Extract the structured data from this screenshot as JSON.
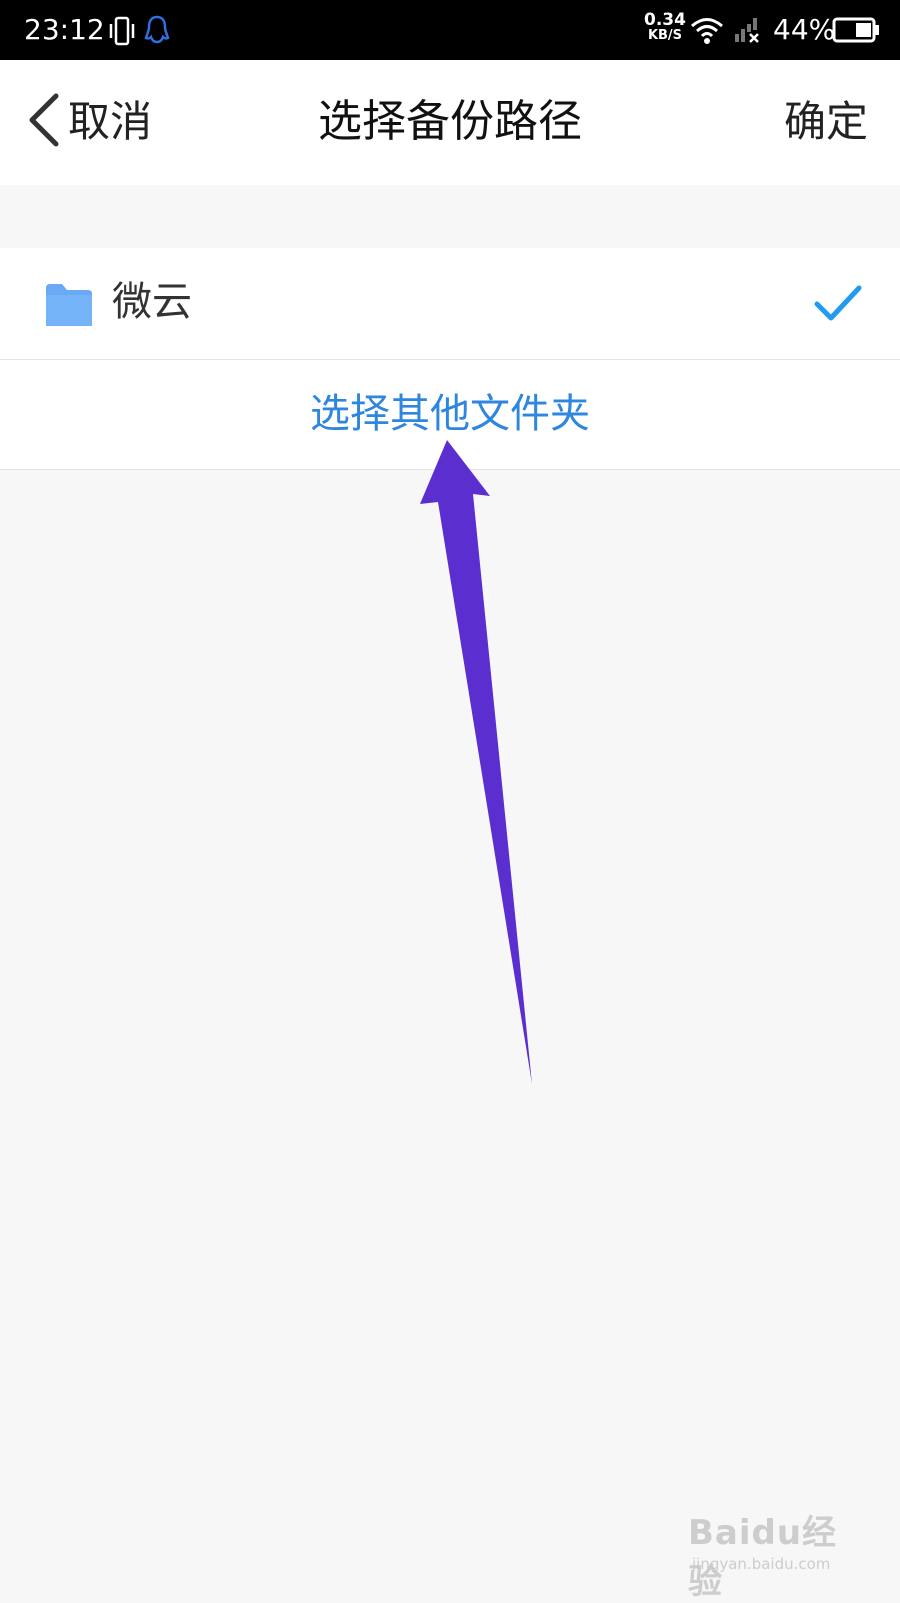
{
  "status_bar": {
    "time": "23:12",
    "net_speed_value": "0.34",
    "net_speed_unit": "KB/S",
    "battery_percent": "44%",
    "icons": [
      "vibrate-icon",
      "qq-icon",
      "wifi-icon",
      "signal-icon",
      "battery-icon"
    ]
  },
  "header": {
    "back_label": "取消",
    "title": "选择备份路径",
    "confirm_label": "确定"
  },
  "list": {
    "folder_item": {
      "label": "微云",
      "icon": "folder-icon",
      "selected": true
    },
    "other_folder_label": "选择其他文件夹"
  },
  "colors": {
    "accent_blue": "#2e86de",
    "folder_blue": "#6aaaf5",
    "check_blue": "#1f9bf0",
    "arrow_purple": "#5b2fcf"
  },
  "watermark": {
    "main": "Baidu经验",
    "sub": "jingyan.baidu.com"
  }
}
